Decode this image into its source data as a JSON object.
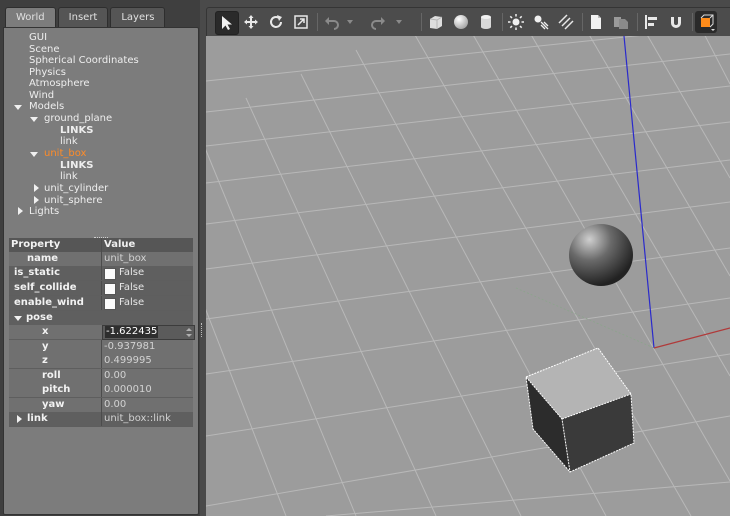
{
  "tabs": [
    {
      "label": "World",
      "active": true
    },
    {
      "label": "Insert",
      "active": false
    },
    {
      "label": "Layers",
      "active": false
    }
  ],
  "tree": {
    "gui": "GUI",
    "scene": "Scene",
    "spherical": "Spherical Coordinates",
    "physics": "Physics",
    "atmosphere": "Atmosphere",
    "wind": "Wind",
    "models": "Models",
    "ground_plane": "ground_plane",
    "gp_links": "LINKS",
    "gp_link": "link",
    "unit_box": "unit_box",
    "ub_links": "LINKS",
    "ub_link": "link",
    "unit_cylinder": "unit_cylinder",
    "unit_sphere": "unit_sphere",
    "lights": "Lights"
  },
  "properties": {
    "header_property": "Property",
    "header_value": "Value",
    "name_label": "name",
    "name_value": "unit_box",
    "is_static_label": "is_static",
    "is_static_value": "False",
    "self_collide_label": "self_collide",
    "self_collide_value": "False",
    "enable_wind_label": "enable_wind",
    "enable_wind_value": "False",
    "pose_label": "pose",
    "x_label": "x",
    "x_value": "-1.622435",
    "y_label": "y",
    "y_value": "-0.937981",
    "z_label": "z",
    "z_value": "0.499995",
    "roll_label": "roll",
    "roll_value": "0.00",
    "pitch_label": "pitch",
    "pitch_value": "0.000010",
    "yaw_label": "yaw",
    "yaw_value": "0.00",
    "link_label": "link",
    "link_value": "unit_box::link"
  },
  "colors": {
    "selected_text": "#ff8c28",
    "viewport_bg": "#9c9c9c",
    "z_axis": "#2a2acc",
    "x_axis": "#b03a3a"
  },
  "toolbar_icons": [
    "select-icon",
    "translate-icon",
    "rotate-icon",
    "scale-icon",
    "undo-icon",
    "undo-history-icon",
    "redo-icon",
    "redo-history-icon",
    "box-icon",
    "sphere-icon",
    "cylinder-icon",
    "point-light-icon",
    "spot-light-icon",
    "directional-light-icon",
    "copy-icon",
    "paste-icon",
    "align-icon",
    "snap-icon",
    "view-angle-icon"
  ]
}
